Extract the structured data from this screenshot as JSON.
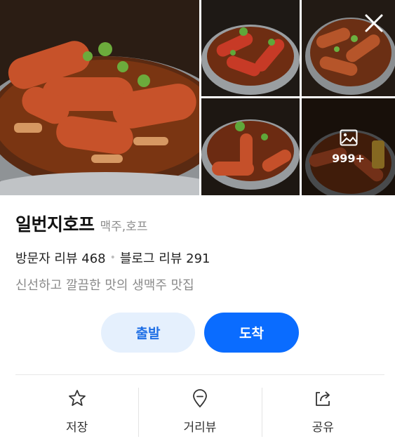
{
  "gallery": {
    "photos": [
      {
        "icon": "food-photo"
      },
      {
        "icon": "food-photo"
      },
      {
        "icon": "food-photo"
      },
      {
        "icon": "food-photo"
      },
      {
        "icon": "food-photo"
      }
    ],
    "more_count": "999+",
    "close_icon": "close-icon",
    "more_icon": "image-icon"
  },
  "place": {
    "name": "일번지호프",
    "category": "맥주,호프",
    "visitor_reviews": "방문자 리뷰 468",
    "blog_reviews": "블로그 리뷰 291",
    "tagline": "신선하고 깔끔한 맛의 생맥주 맛집"
  },
  "actions": {
    "depart_label": "출발",
    "arrive_label": "도착"
  },
  "toolbar": {
    "save_label": "저장",
    "distance_label": "거리뷰",
    "share_label": "공유"
  },
  "colors": {
    "primary": "#0a6cff",
    "primary_light": "#e5f0fd"
  }
}
